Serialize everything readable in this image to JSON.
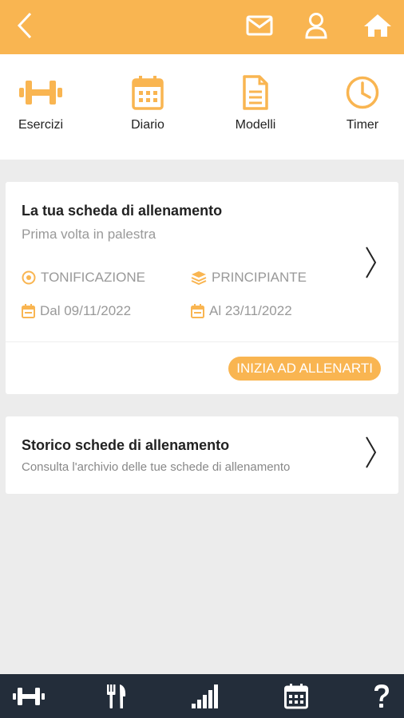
{
  "colors": {
    "accent": "#f9b551",
    "background": "#ececec",
    "bottom_bar": "#232d3a",
    "muted_text": "#999999"
  },
  "header": {
    "icons": [
      "back-arrow-icon",
      "mail-icon",
      "user-icon",
      "home-icon"
    ]
  },
  "quick_nav": {
    "items": [
      {
        "label": "Esercizi",
        "icon": "dumbbell-icon"
      },
      {
        "label": "Diario",
        "icon": "calendar-icon"
      },
      {
        "label": "Modelli",
        "icon": "document-icon"
      },
      {
        "label": "Timer",
        "icon": "clock-icon"
      }
    ]
  },
  "current_plan": {
    "title": "La tua scheda di allenamento",
    "subtitle": "Prima volta in palestra",
    "goal": "TONIFICAZIONE",
    "level": "PRINCIPIANTE",
    "start_date": "Dal 09/11/2022",
    "end_date": "Al 23/11/2022",
    "start_button": "INIZIA AD ALLENARTI"
  },
  "history": {
    "title": "Storico schede di allenamento",
    "subtitle": "Consulta l'archivio delle tue schede di allenamento"
  },
  "bottom_nav": {
    "icons": [
      "dumbbell-icon",
      "fork-knife-icon",
      "signal-bars-icon",
      "calendar-icon",
      "help-icon"
    ]
  }
}
